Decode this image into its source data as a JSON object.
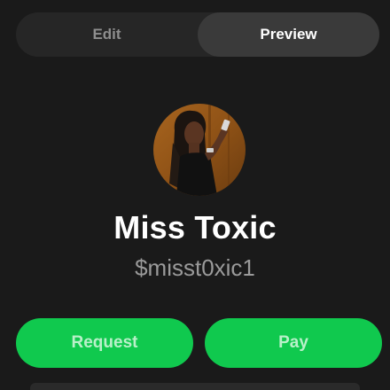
{
  "tabs": {
    "edit_label": "Edit",
    "preview_label": "Preview",
    "selected": "Preview"
  },
  "profile": {
    "name": "Miss Toxic",
    "cashtag": "$misst0xic1"
  },
  "actions": {
    "request_label": "Request",
    "pay_label": "Pay"
  },
  "colors": {
    "background": "#1a1a1a",
    "segment_bg": "#262626",
    "segment_active": "#3a3a3a",
    "accent_green": "#10c94e",
    "button_text": "#b9f0c9",
    "muted_text": "#9a9a9a"
  }
}
